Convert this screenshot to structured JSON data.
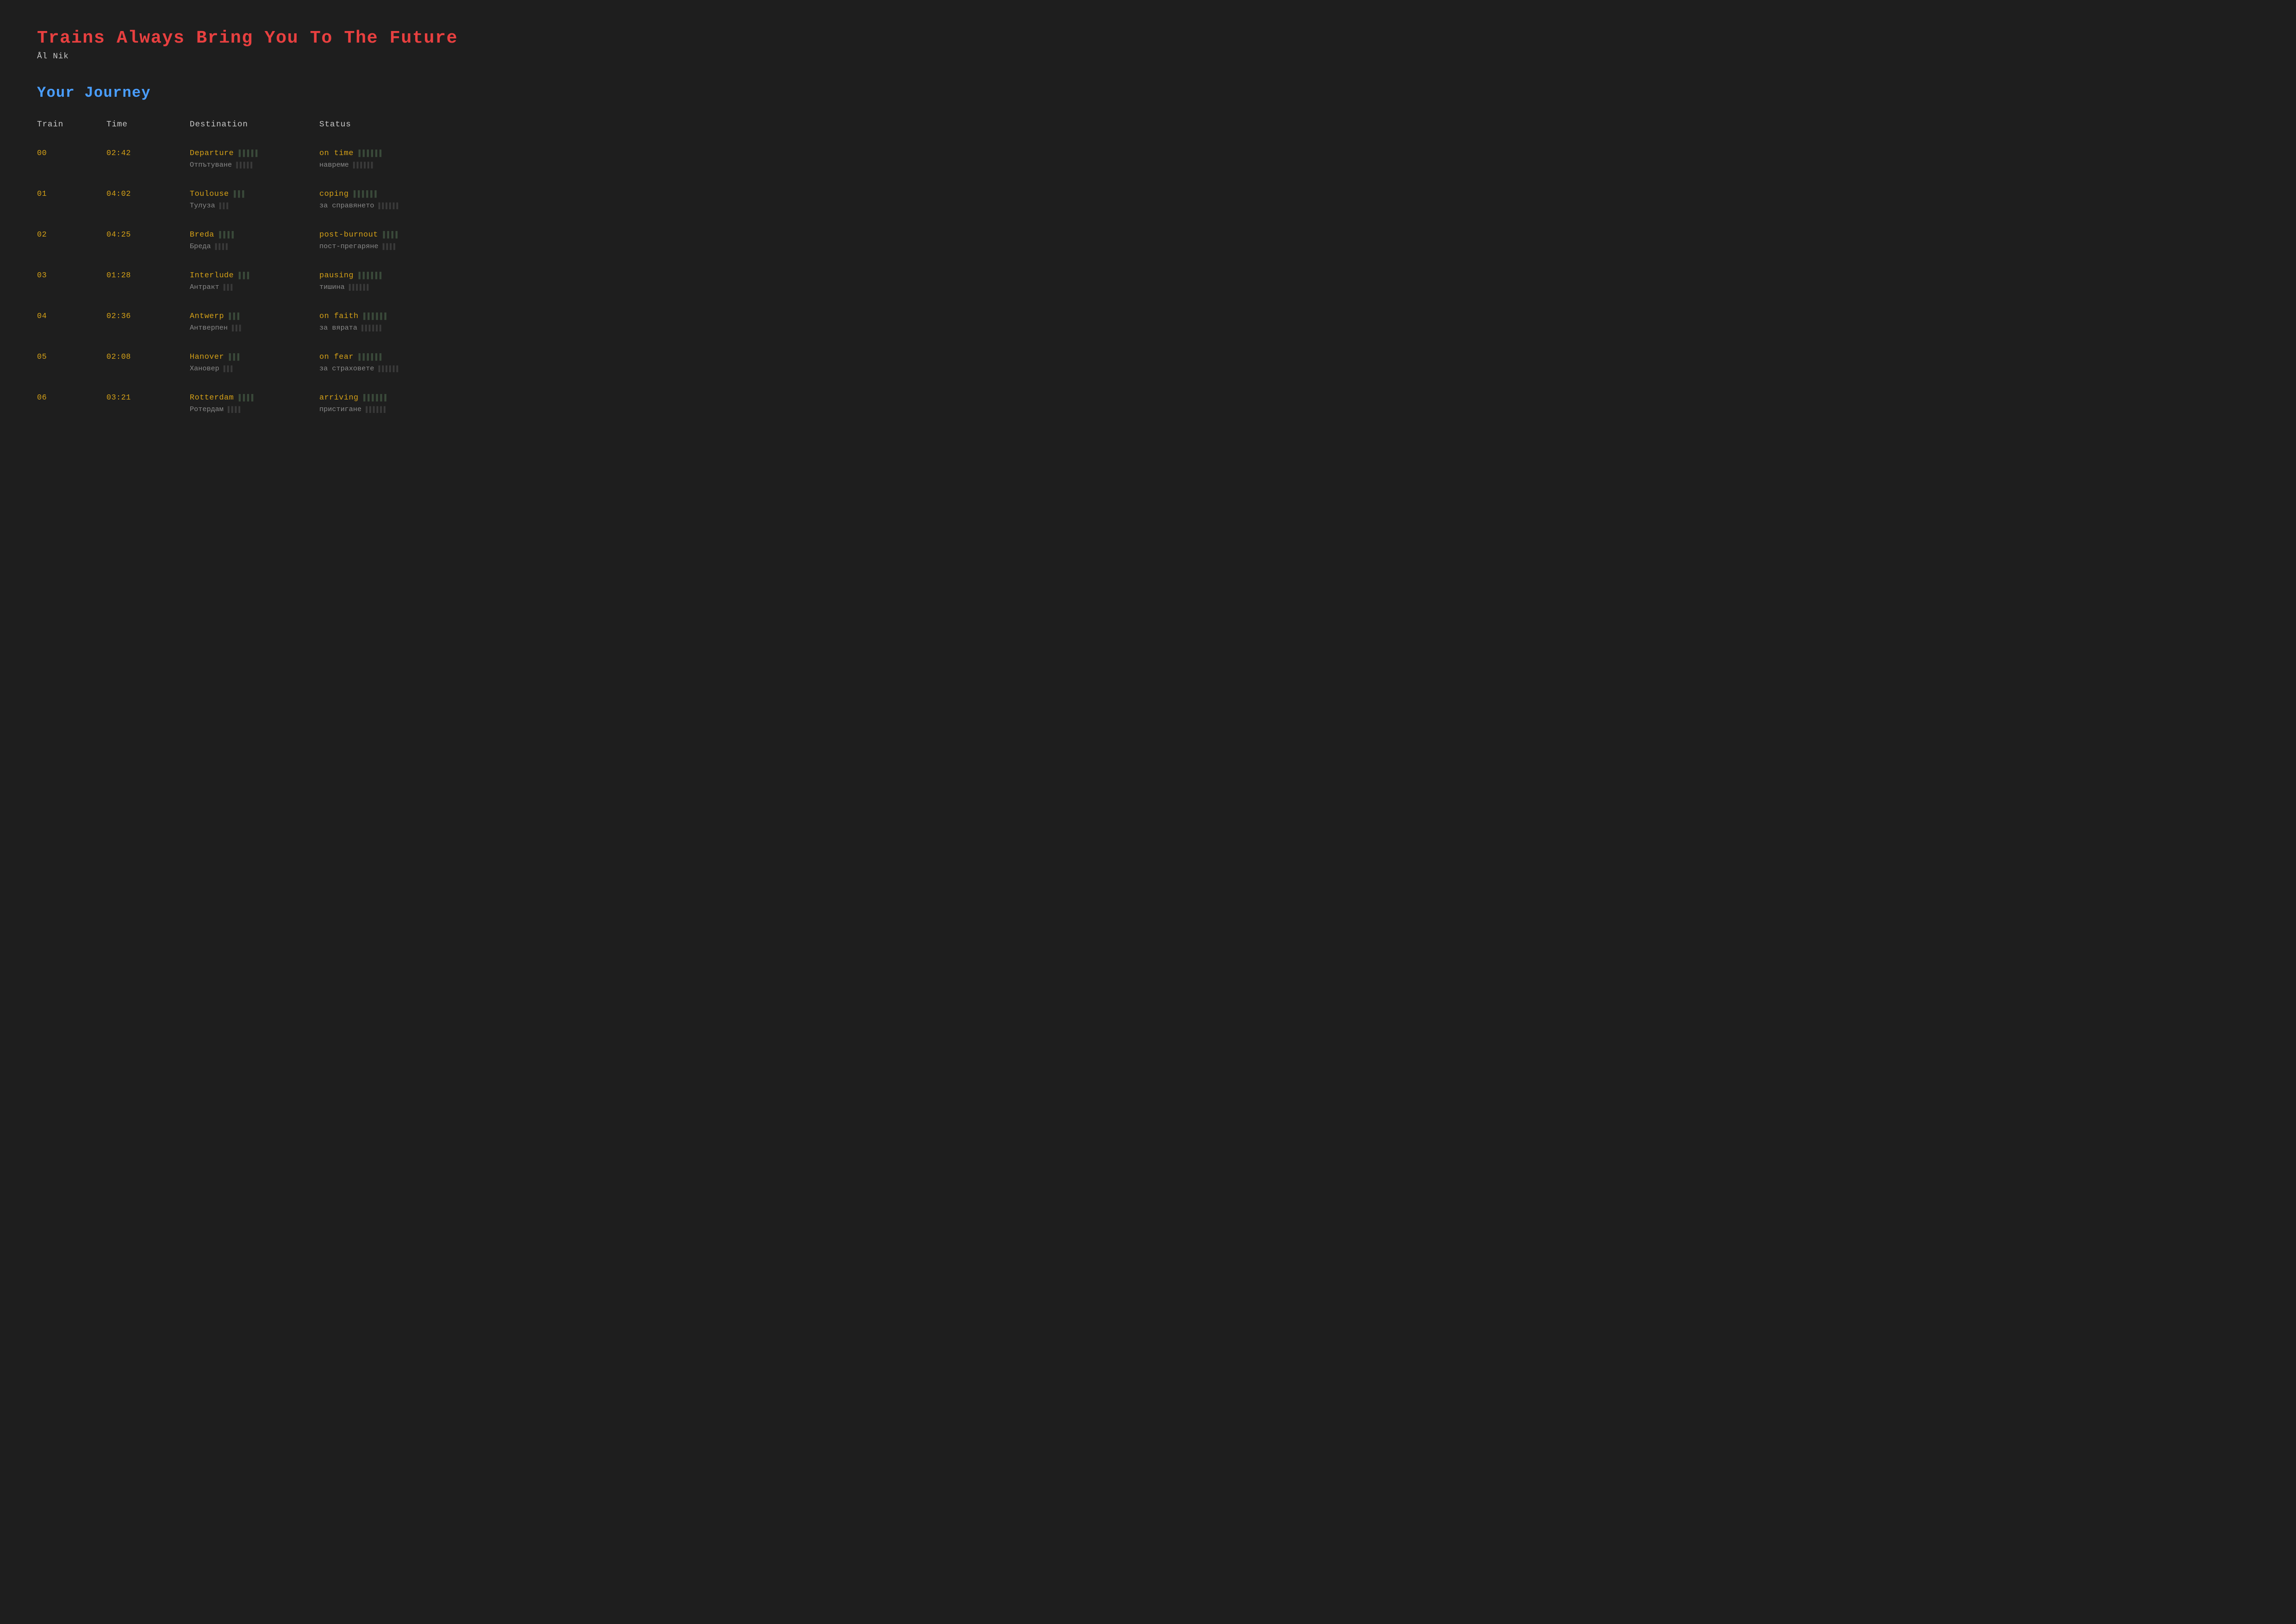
{
  "header": {
    "title": "Trains Always Bring You To The Future",
    "subtitle": "Ål Nik"
  },
  "section": {
    "title": "Your Journey"
  },
  "columns": {
    "train": "Train",
    "time": "Time",
    "destination": "Destination",
    "status": "Status"
  },
  "rows": [
    {
      "train": "00",
      "time": "02:42",
      "dest_en": "Departure",
      "dest_bg": "Отпътуване",
      "status_en": "on time",
      "status_bg": "навреме",
      "flap_dest": "▌▌▌▌▌",
      "flap_status": "▌▌▌▌▌▌"
    },
    {
      "train": "01",
      "time": "04:02",
      "dest_en": "Toulouse",
      "dest_bg": "Тулуза",
      "status_en": "coping",
      "status_bg": "за справянето",
      "flap_dest": "▌▌▌",
      "flap_status": "▌▌▌▌▌▌"
    },
    {
      "train": "02",
      "time": "04:25",
      "dest_en": "Breda",
      "dest_bg": "Бреда",
      "status_en": "post-burnout",
      "status_bg": "пост-прегаряне",
      "flap_dest": "▌▌▌▌",
      "flap_status": "▌▌▌▌"
    },
    {
      "train": "03",
      "time": "01:28",
      "dest_en": "Interlude",
      "dest_bg": "Антракт",
      "status_en": "pausing",
      "status_bg": "тишина",
      "flap_dest": "▌▌▌",
      "flap_status": "▌▌▌▌▌▌"
    },
    {
      "train": "04",
      "time": "02:36",
      "dest_en": "Antwerp",
      "dest_bg": "Антверпен",
      "status_en": "on faith",
      "status_bg": "за вярата",
      "flap_dest": "▌▌▌",
      "flap_status": "▌▌▌▌▌▌"
    },
    {
      "train": "05",
      "time": "02:08",
      "dest_en": "Hanover",
      "dest_bg": "Хановер",
      "status_en": "on fear",
      "status_bg": "за страховете",
      "flap_dest": "▌▌▌",
      "flap_status": "▌▌▌▌▌▌"
    },
    {
      "train": "06",
      "time": "03:21",
      "dest_en": "Rotterdam",
      "dest_bg": "Ротердам",
      "status_en": "arriving",
      "status_bg": "пристигане",
      "flap_dest": "▌▌▌▌",
      "flap_status": "▌▌▌▌▌▌"
    }
  ]
}
